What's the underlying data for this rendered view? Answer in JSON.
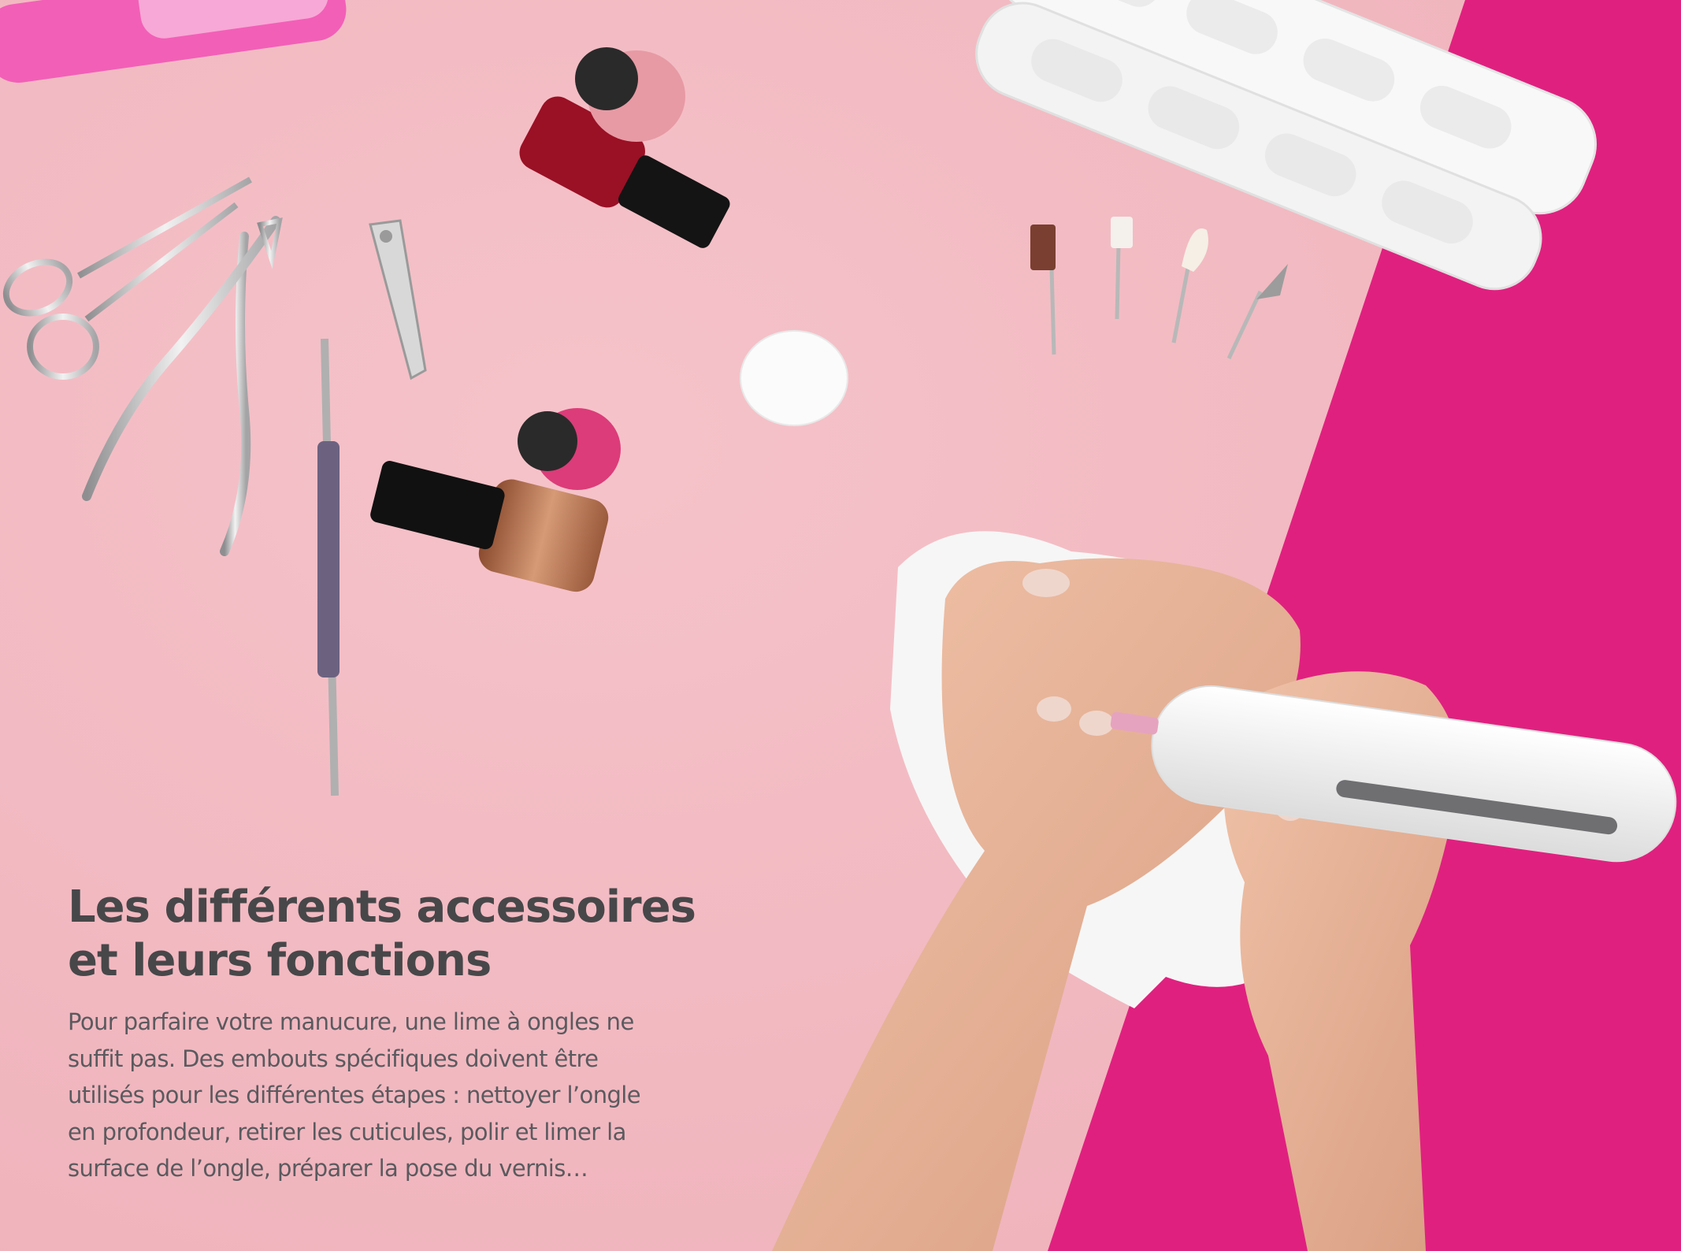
{
  "article": {
    "title_lines": [
      "Les différents accessoires",
      "et leurs fonctions"
    ],
    "body_lines": [
      "Pour parfaire votre manucure, une lime à ongles ne",
      "suffit pas. Des embouts spécifiques doivent être",
      "utilisés pour les différentes étapes : nettoyer l’ongle",
      "en profondeur, retirer les cuticules, polir et limer la",
      "surface de l’ongle, préparer la pose du vernis…"
    ]
  },
  "colors": {
    "background_pink": "#f2b8c0",
    "magenta": "#e0207f",
    "title_text": "#474749",
    "body_text": "#5a5a5e",
    "device_white": "#fafafa",
    "skin": "#e8b49a"
  }
}
